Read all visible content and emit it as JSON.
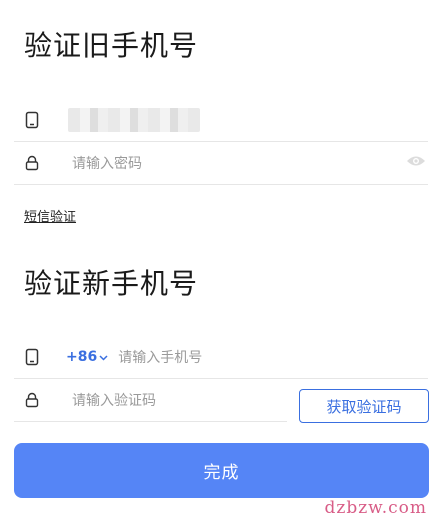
{
  "old_phone_section": {
    "title": "验证旧手机号",
    "password_placeholder": "请输入密码",
    "sms_verify_link": "短信验证"
  },
  "new_phone_section": {
    "title": "验证新手机号",
    "country_code": "+86",
    "phone_placeholder": "请输入手机号",
    "code_placeholder": "请输入验证码",
    "get_code_label": "获取验证码"
  },
  "done_label": "完成",
  "watermark": "dzbzw.com",
  "colors": {
    "accent": "#3a6fe0",
    "primary_button": "#5585f6",
    "divider": "#e6e6e6",
    "placeholder": "#9a9a9a"
  },
  "icons": {
    "phone": "phone-icon",
    "lock": "lock-icon",
    "eye": "eye-icon",
    "chevron": "chevron-down-icon"
  }
}
